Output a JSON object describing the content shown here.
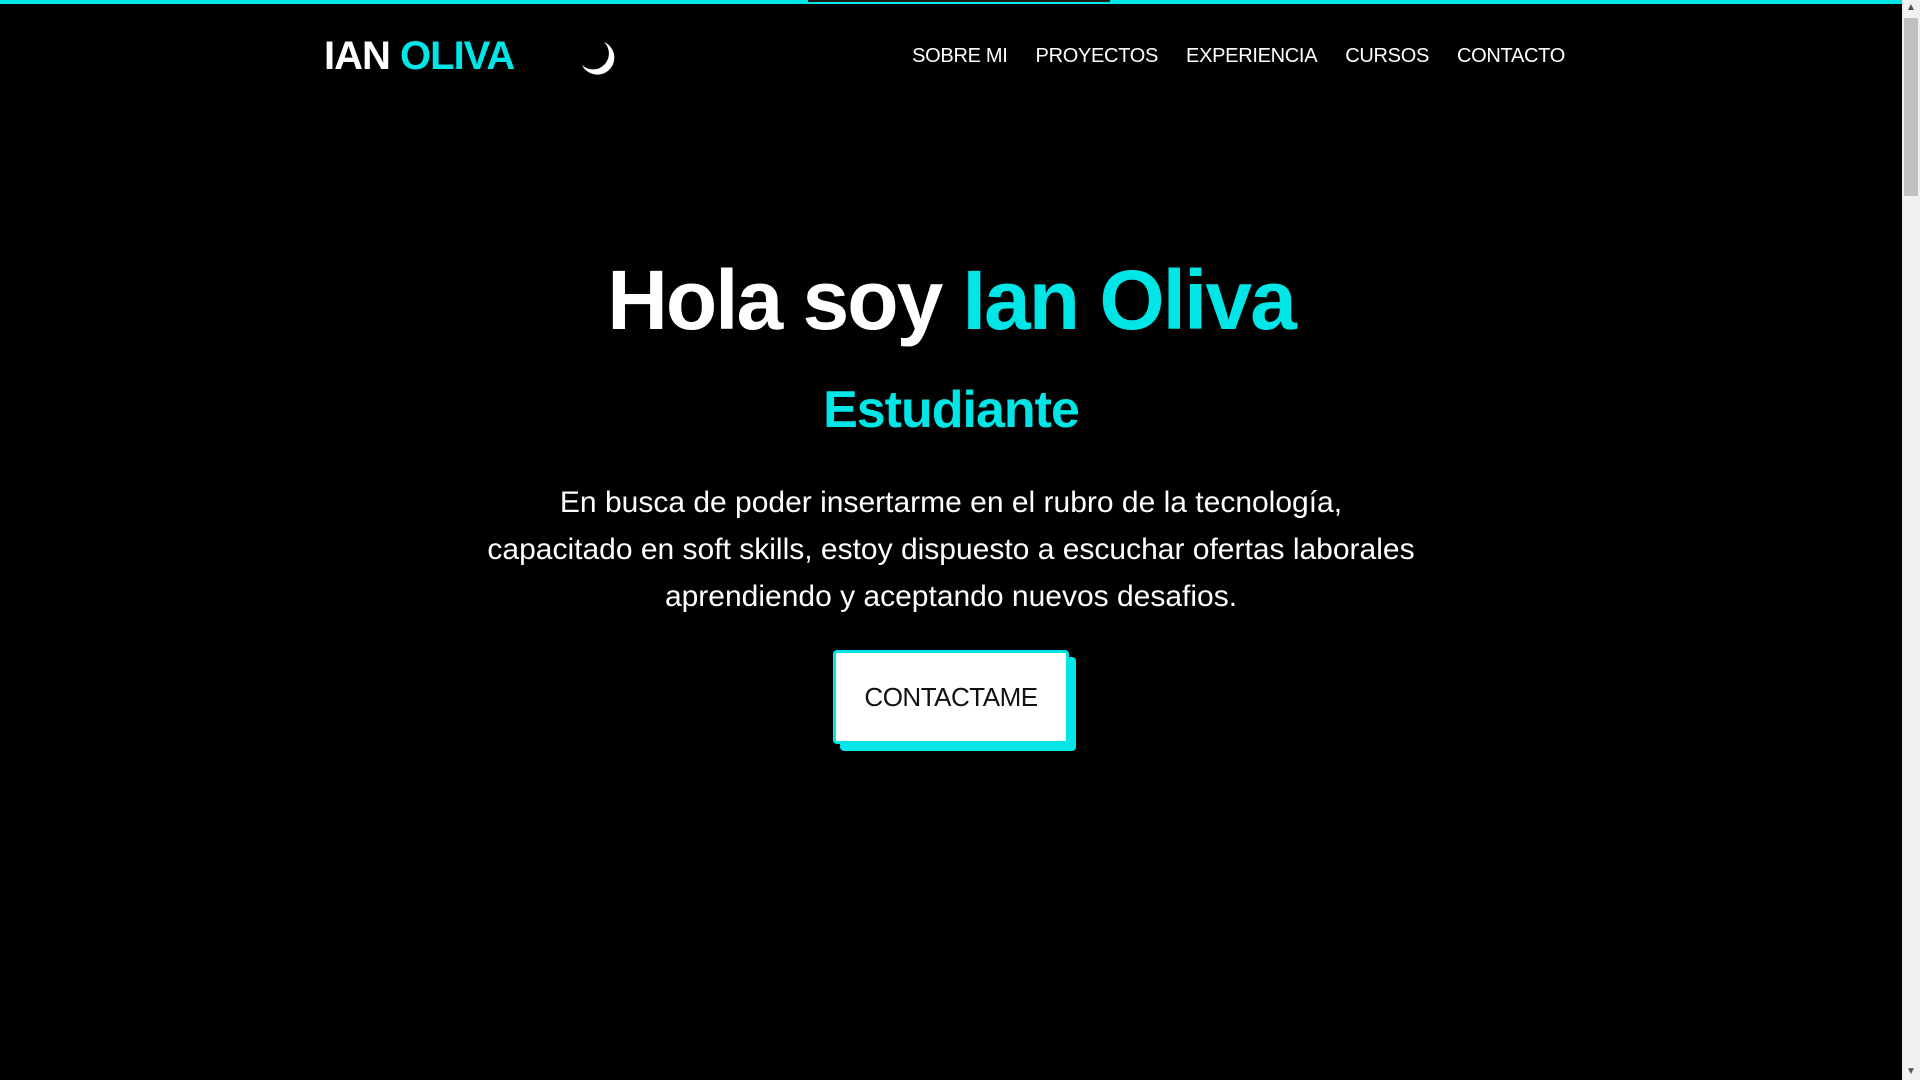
{
  "colors": {
    "background": "#000000",
    "accent": "#00e5e5",
    "text": "#ffffff"
  },
  "header": {
    "brand_first": "IAN",
    "brand_second": "OLIVA",
    "theme_icon": "moon-icon",
    "nav": [
      {
        "label": "SOBRE MI"
      },
      {
        "label": "PROYECTOS"
      },
      {
        "label": "EXPERIENCIA"
      },
      {
        "label": "CURSOS"
      },
      {
        "label": "CONTACTO"
      }
    ]
  },
  "hero": {
    "greeting": "Hola soy",
    "name": "Ian Oliva",
    "role": "Estudiante",
    "description_lines": [
      "En busca de poder insertarme en el rubro de la tecnología,",
      "capacitado en soft skills, estoy dispuesto a escuchar ofertas laborales",
      "aprendiendo y aceptando nuevos desafios."
    ],
    "cta_label": "CONTACTAME"
  },
  "scrollbar": {
    "up_icon": "chevron-up-icon",
    "down_icon": "chevron-down-icon"
  }
}
